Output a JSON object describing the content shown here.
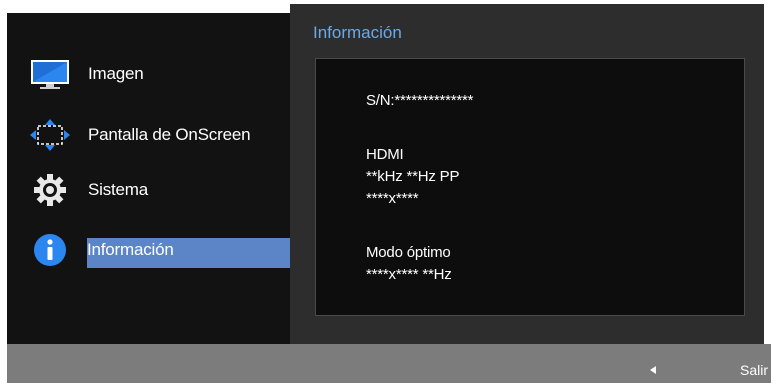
{
  "menu": {
    "items": [
      {
        "label": "Imagen",
        "icon": "monitor-icon"
      },
      {
        "label": "Pantalla de OnScreen",
        "icon": "osd-arrows-icon"
      },
      {
        "label": "Sistema",
        "icon": "gear-icon"
      },
      {
        "label": "Información",
        "icon": "info-icon",
        "selected": true
      }
    ]
  },
  "info_panel": {
    "title": "Información",
    "serial": "S/N:**************",
    "source": "HDMI",
    "frequency": "**kHz **Hz PP",
    "resolution": "****x****",
    "optimal_mode_label": "Modo óptimo",
    "optimal_mode_value": "****x**** **Hz"
  },
  "bottom_bar": {
    "exit_label": "Salir",
    "back_icon": "left-arrow-icon"
  },
  "colors": {
    "accent": "#5b85c6",
    "title": "#6aa9e8",
    "menu_bg": "#121212",
    "panel_bg": "#2d2d2d",
    "bottom_bar": "#7c7c7c"
  }
}
